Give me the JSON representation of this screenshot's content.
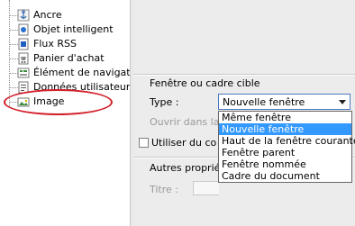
{
  "tree": {
    "items": [
      {
        "label": "Ancre",
        "icon": "anchor-icon"
      },
      {
        "label": "Objet intelligent",
        "icon": "smart-object-icon"
      },
      {
        "label": "Flux RSS",
        "icon": "rss-feed-icon"
      },
      {
        "label": "Panier d'achat",
        "icon": "shopping-cart-icon"
      },
      {
        "label": "Élément de navigation",
        "icon": "navigation-element-icon"
      },
      {
        "label": "Données utilisateur",
        "icon": "user-data-icon"
      },
      {
        "label": "Image",
        "icon": "image-icon"
      }
    ]
  },
  "panel": {
    "target_group_title": "Fenêtre ou cadre cible",
    "type_label": "Type :",
    "type_value": "Nouvelle fenêtre",
    "open_in_label": "Ouvrir dans la fenê",
    "use_checkbox_label": "Utiliser du co",
    "other_group_title": "Autres propriété",
    "title_label": "Titre :"
  },
  "dropdown": {
    "options": [
      "Même fenêtre",
      "Nouvelle fenêtre",
      "Haut de la fenêtre courante",
      "Fenêtre parent",
      "Fenêtre nommée",
      "Cadre du document"
    ],
    "selected_index": 1
  },
  "colors": {
    "highlight": "#d2202a",
    "selection": "#3399ff",
    "panel_bg": "#ececec"
  }
}
